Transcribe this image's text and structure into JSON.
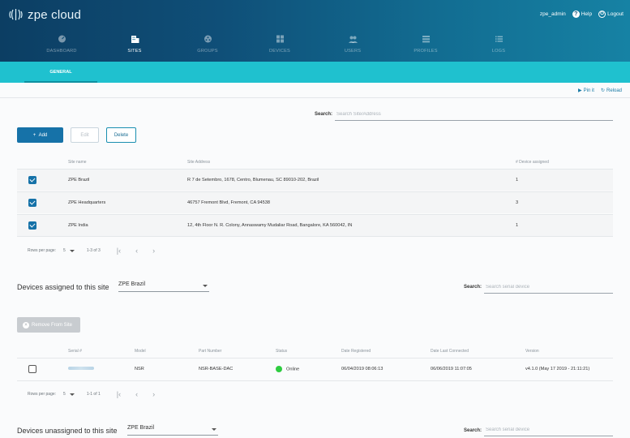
{
  "brand": {
    "name": "zpe cloud"
  },
  "user": {
    "name": "zpe_admin",
    "help": "Help",
    "logout": "Logout"
  },
  "nav": [
    {
      "label": "DASHBOARD",
      "icon": "dashboard-icon",
      "active": false
    },
    {
      "label": "SITES",
      "icon": "building-icon",
      "active": true
    },
    {
      "label": "GROUPS",
      "icon": "groups-icon",
      "active": false
    },
    {
      "label": "DEVICES",
      "icon": "devices-icon",
      "active": false
    },
    {
      "label": "USERS",
      "icon": "users-icon",
      "active": false
    },
    {
      "label": "PROFILES",
      "icon": "profiles-icon",
      "active": false
    },
    {
      "label": "LOGS",
      "icon": "logs-icon",
      "active": false
    }
  ],
  "tabs": [
    {
      "label": "GENERAL"
    }
  ],
  "actions": {
    "pin": "Pin it",
    "reload": "Reload"
  },
  "sites_search": {
    "label": "Search:",
    "placeholder": "Search Site/Address"
  },
  "toolbar": {
    "add": "Add",
    "edit": "Edit",
    "delete": "Delete"
  },
  "sites_table": {
    "headers": [
      "Site name",
      "Site Address",
      "# Device assigned"
    ],
    "rows": [
      {
        "name": "ZPE Brazil",
        "address": "R 7 de Setembro, 1678, Centro, Blumenau, SC 89010-202, Brazil",
        "count": "1",
        "checked": true
      },
      {
        "name": "ZPE Headquarters",
        "address": "46757 Fremont Blvd, Fremont, CA 94538",
        "count": "3",
        "checked": true
      },
      {
        "name": "ZPE India",
        "address": "12, 4th Floor N. R. Colony, Annaswamy Mudaliar Road, Bangalore, KA 560042, IN",
        "count": "1",
        "checked": true
      }
    ],
    "pager": {
      "rows_label": "Rows per page:",
      "rows_value": "5",
      "range": "1-3 of 3"
    }
  },
  "assigned": {
    "title": "Devices assigned to this site",
    "site": "ZPE Brazil",
    "search_label": "Search:",
    "search_placeholder": "Search serial device",
    "remove_label": "Remove From Site",
    "headers": [
      "Serial #",
      "Model",
      "Part Number",
      "Status",
      "Date Registered",
      "Date Last Connected",
      "Version"
    ],
    "rows": [
      {
        "model": "NSR",
        "part": "NSR-BASE-DAC",
        "status": "Online",
        "registered": "06/04/2019 08:06:13",
        "last_connected": "06/06/2019 11:07:05",
        "version": "v4.1.0 (May 17 2019 - 21:11:21)"
      }
    ],
    "pager": {
      "rows_label": "Rows per page:",
      "rows_value": "5",
      "range": "1-1 of 1"
    }
  },
  "unassigned": {
    "title": "Devices unassigned to this site",
    "site": "ZPE Brazil",
    "search_label": "Search:",
    "search_placeholder": "Search serial device"
  },
  "colors": {
    "primary": "#1672a8",
    "tabbar": "#1fc1cf",
    "online": "#2ecc40"
  }
}
